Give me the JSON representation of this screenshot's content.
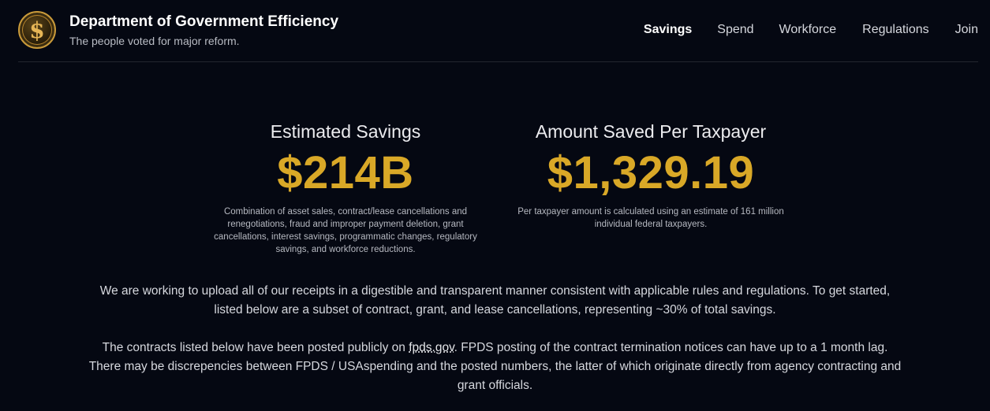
{
  "header": {
    "title": "Department of Government Efficiency",
    "subtitle": "The people voted for major reform.",
    "logo_glyph": "$",
    "nav": [
      "Savings",
      "Spend",
      "Workforce",
      "Regulations",
      "Join"
    ]
  },
  "stats": {
    "savings": {
      "label": "Estimated Savings",
      "value": "$214B",
      "note": "Combination of asset sales, contract/lease cancellations and renegotiations, fraud and improper payment deletion, grant cancellations, interest savings, programmatic changes, regulatory savings, and workforce reductions."
    },
    "per_taxpayer": {
      "label": "Amount Saved Per Taxpayer",
      "value": "$1,329.19",
      "note": "Per taxpayer amount is calculated using an estimate of 161 million individual federal taxpayers."
    }
  },
  "intro": {
    "paragraph1": "We are working to upload all of our receipts in a digestible and transparent manner consistent with applicable rules and regulations. To get started, listed below are a subset of contract, grant, and lease cancellations, representing ~30% of total savings.",
    "paragraph2_before": "The contracts listed below have been posted publicly on ",
    "paragraph2_link": "fpds.gov",
    "paragraph2_after": ". FPDS posting of the contract termination notices can have up to a 1 month lag. There may be discrepencies between FPDS / USAspending and the posted numbers, the latter of which originate directly from agency contracting and grant officials."
  },
  "colors": {
    "background": "#050812",
    "accent_gold": "#d9a827"
  }
}
